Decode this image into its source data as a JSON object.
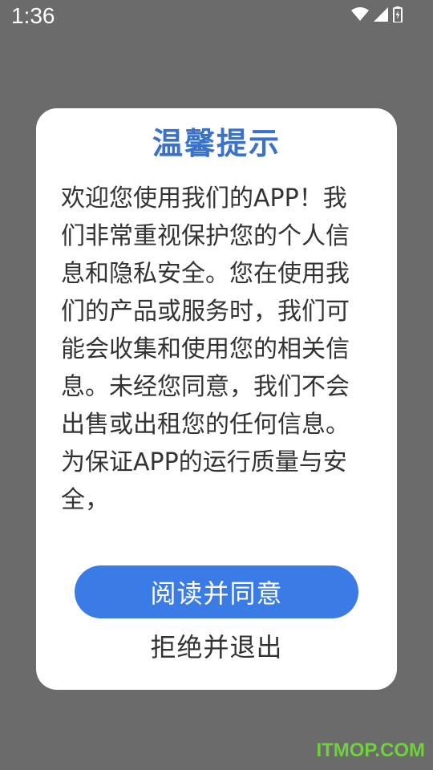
{
  "status_bar": {
    "time": "1:36",
    "icons": [
      "wifi-icon",
      "cellular-signal-icon",
      "battery-charging-icon"
    ]
  },
  "dialog": {
    "title": "温馨提示",
    "body": "欢迎您使用我们的APP！我们非常重视保护您的个人信息和隐私安全。您在使用我们的产品或服务时，我们可能会收集和使用您的相关信息。未经您同意，我们不会出售或出租您的任何信息。为保证APP的运行质量与安全，",
    "agree_label": "阅读并同意",
    "exit_label": "拒绝并退出"
  },
  "watermark": {
    "text": "ITMOP.COM"
  },
  "colors": {
    "overlay": "#6b6b6b",
    "title": "#3a72c8",
    "primary_button": "#3b7be6",
    "watermark": "#6fd23c"
  }
}
